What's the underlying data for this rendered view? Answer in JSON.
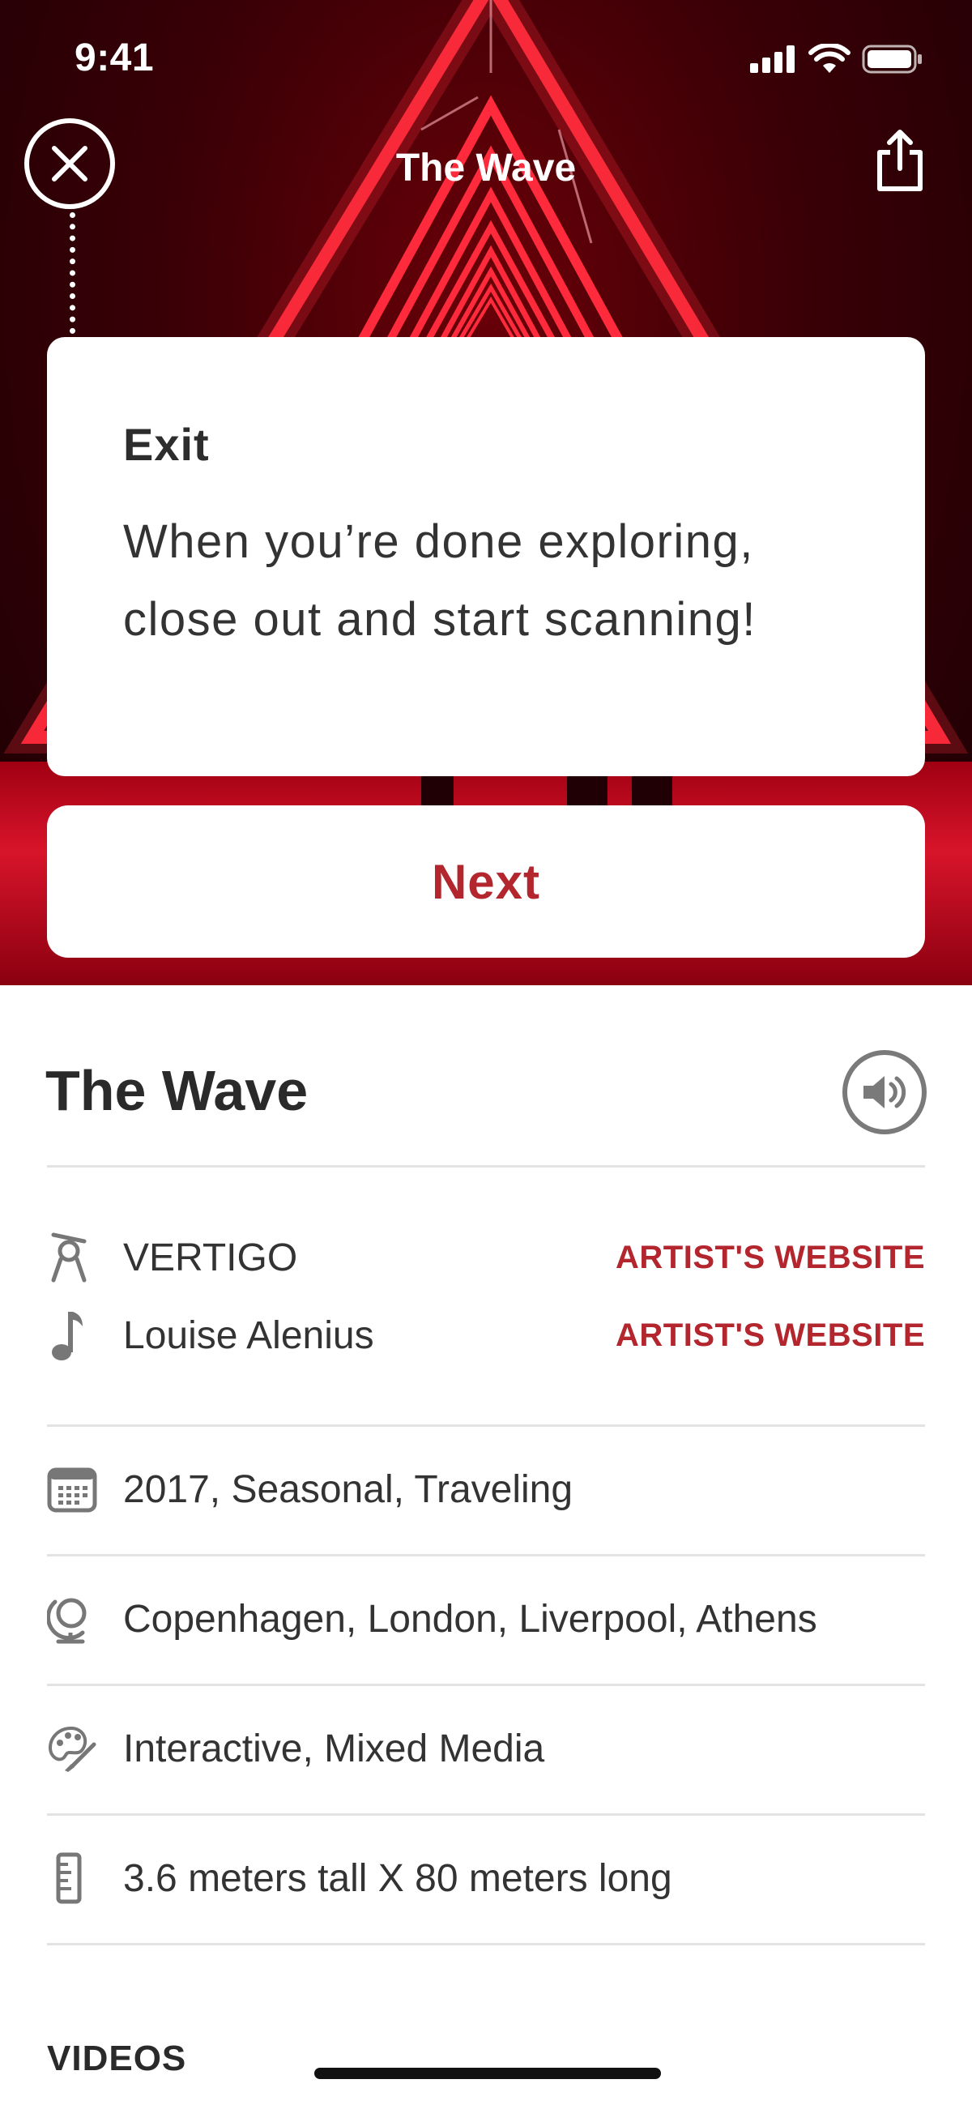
{
  "status_bar": {
    "time": "9:41"
  },
  "nav": {
    "title": "The Wave"
  },
  "tip": {
    "title": "Exit",
    "body_line1": "When you’re done exploring,",
    "body_line2": "close out and start scanning!",
    "next_label": "Next"
  },
  "artwork": {
    "title": "The Wave",
    "artists": [
      {
        "icon": "artist-icon",
        "name": "VERTIGO",
        "link_label": "ARTIST'S WEBSITE"
      },
      {
        "icon": "music-note-icon",
        "name": "Louise Alenius",
        "link_label": "ARTIST'S WEBSITE"
      }
    ],
    "details": [
      {
        "icon": "calendar-icon",
        "text": "2017, Seasonal, Traveling"
      },
      {
        "icon": "globe-icon",
        "text": "Copenhagen, London, Liverpool, Athens"
      },
      {
        "icon": "palette-icon",
        "text": "Interactive, Mixed Media"
      },
      {
        "icon": "ruler-icon",
        "text": "3.6 meters tall X 80 meters long"
      }
    ],
    "videos_label": "VIDEOS"
  },
  "colors": {
    "accent": "#b3262e",
    "neon": "#ff2a3c"
  }
}
